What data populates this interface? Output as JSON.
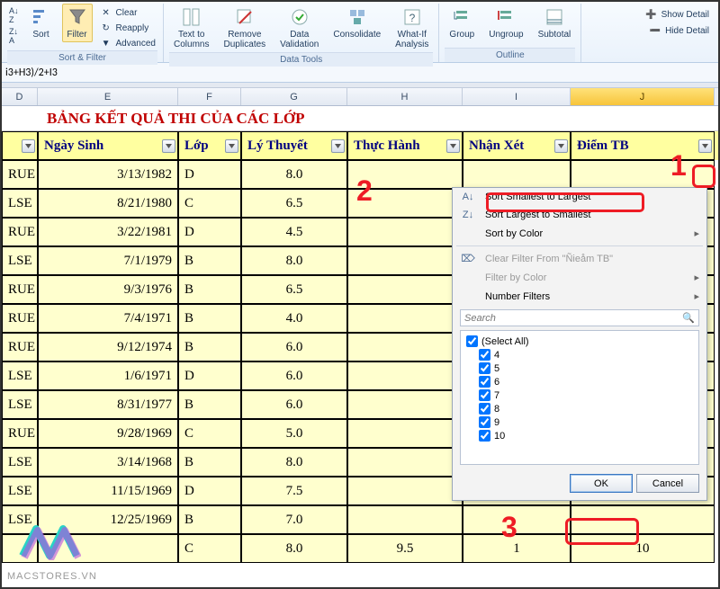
{
  "ribbon": {
    "sort_filter": {
      "sort": "Sort",
      "filter": "Filter",
      "clear": "Clear",
      "reapply": "Reapply",
      "advanced": "Advanced",
      "group": "Sort & Filter"
    },
    "data_tools": {
      "text_to_columns": "Text to\nColumns",
      "remove_dup": "Remove\nDuplicates",
      "validation": "Data\nValidation",
      "consolidate": "Consolidate",
      "whatif": "What-If\nAnalysis",
      "group": "Data Tools"
    },
    "outline": {
      "grp": "Group",
      "ungrp": "Ungroup",
      "subtotal": "Subtotal",
      "group": "Outline"
    },
    "show_detail": "Show Detail",
    "hide_detail": "Hide Detail"
  },
  "formula": "i3+H3)/2+I3",
  "cols": {
    "d": "D",
    "e": "E",
    "f": "F",
    "g": "G",
    "h": "H",
    "i": "I",
    "j": "J"
  },
  "title": "BẢNG KẾT QUẢ THI CỦA CÁC LỚP",
  "headers": {
    "ngaysinh": "Ngày Sinh",
    "lop": "Lớp",
    "lythuyet": "Lý Thuyết",
    "thuchanh": "Thực Hành",
    "nhanxet": "Nhận Xét",
    "diemtb": "Điểm TB"
  },
  "rows": [
    {
      "d": "RUE",
      "e": "3/13/1982",
      "f": "D",
      "g": "8.0"
    },
    {
      "d": "LSE",
      "e": "8/21/1980",
      "f": "C",
      "g": "6.5"
    },
    {
      "d": "RUE",
      "e": "3/22/1981",
      "f": "D",
      "g": "4.5"
    },
    {
      "d": "LSE",
      "e": "7/1/1979",
      "f": "B",
      "g": "8.0"
    },
    {
      "d": "RUE",
      "e": "9/3/1976",
      "f": "B",
      "g": "6.5"
    },
    {
      "d": "RUE",
      "e": "7/4/1971",
      "f": "B",
      "g": "4.0"
    },
    {
      "d": "RUE",
      "e": "9/12/1974",
      "f": "B",
      "g": "6.0"
    },
    {
      "d": "LSE",
      "e": "1/6/1971",
      "f": "D",
      "g": "6.0"
    },
    {
      "d": "LSE",
      "e": "8/31/1977",
      "f": "B",
      "g": "6.0"
    },
    {
      "d": "RUE",
      "e": "9/28/1969",
      "f": "C",
      "g": "5.0"
    },
    {
      "d": "LSE",
      "e": "3/14/1968",
      "f": "B",
      "g": "8.0"
    },
    {
      "d": "LSE",
      "e": "11/15/1969",
      "f": "D",
      "g": "7.5"
    },
    {
      "d": "LSE",
      "e": "12/25/1969",
      "f": "B",
      "g": "7.0"
    },
    {
      "d": "",
      "e": "",
      "f": "C",
      "g": "8.0",
      "h": "9.5",
      "i": "1",
      "j": "10"
    }
  ],
  "menu": {
    "sort_asc": "Sort Smallest to Largest",
    "sort_desc": "Sort Largest to Smallest",
    "sort_color": "Sort by Color",
    "clear_filter": "Clear Filter From \"Ñieåm TB\"",
    "filter_color": "Filter by Color",
    "num_filters": "Number Filters",
    "search_ph": "Search",
    "items": [
      "(Select All)",
      "4",
      "5",
      "6",
      "7",
      "8",
      "9",
      "10"
    ],
    "ok": "OK",
    "cancel": "Cancel"
  },
  "annot": {
    "a1": "1",
    "a2": "2",
    "a3": "3"
  },
  "watermark": "MACSTORES.VN"
}
